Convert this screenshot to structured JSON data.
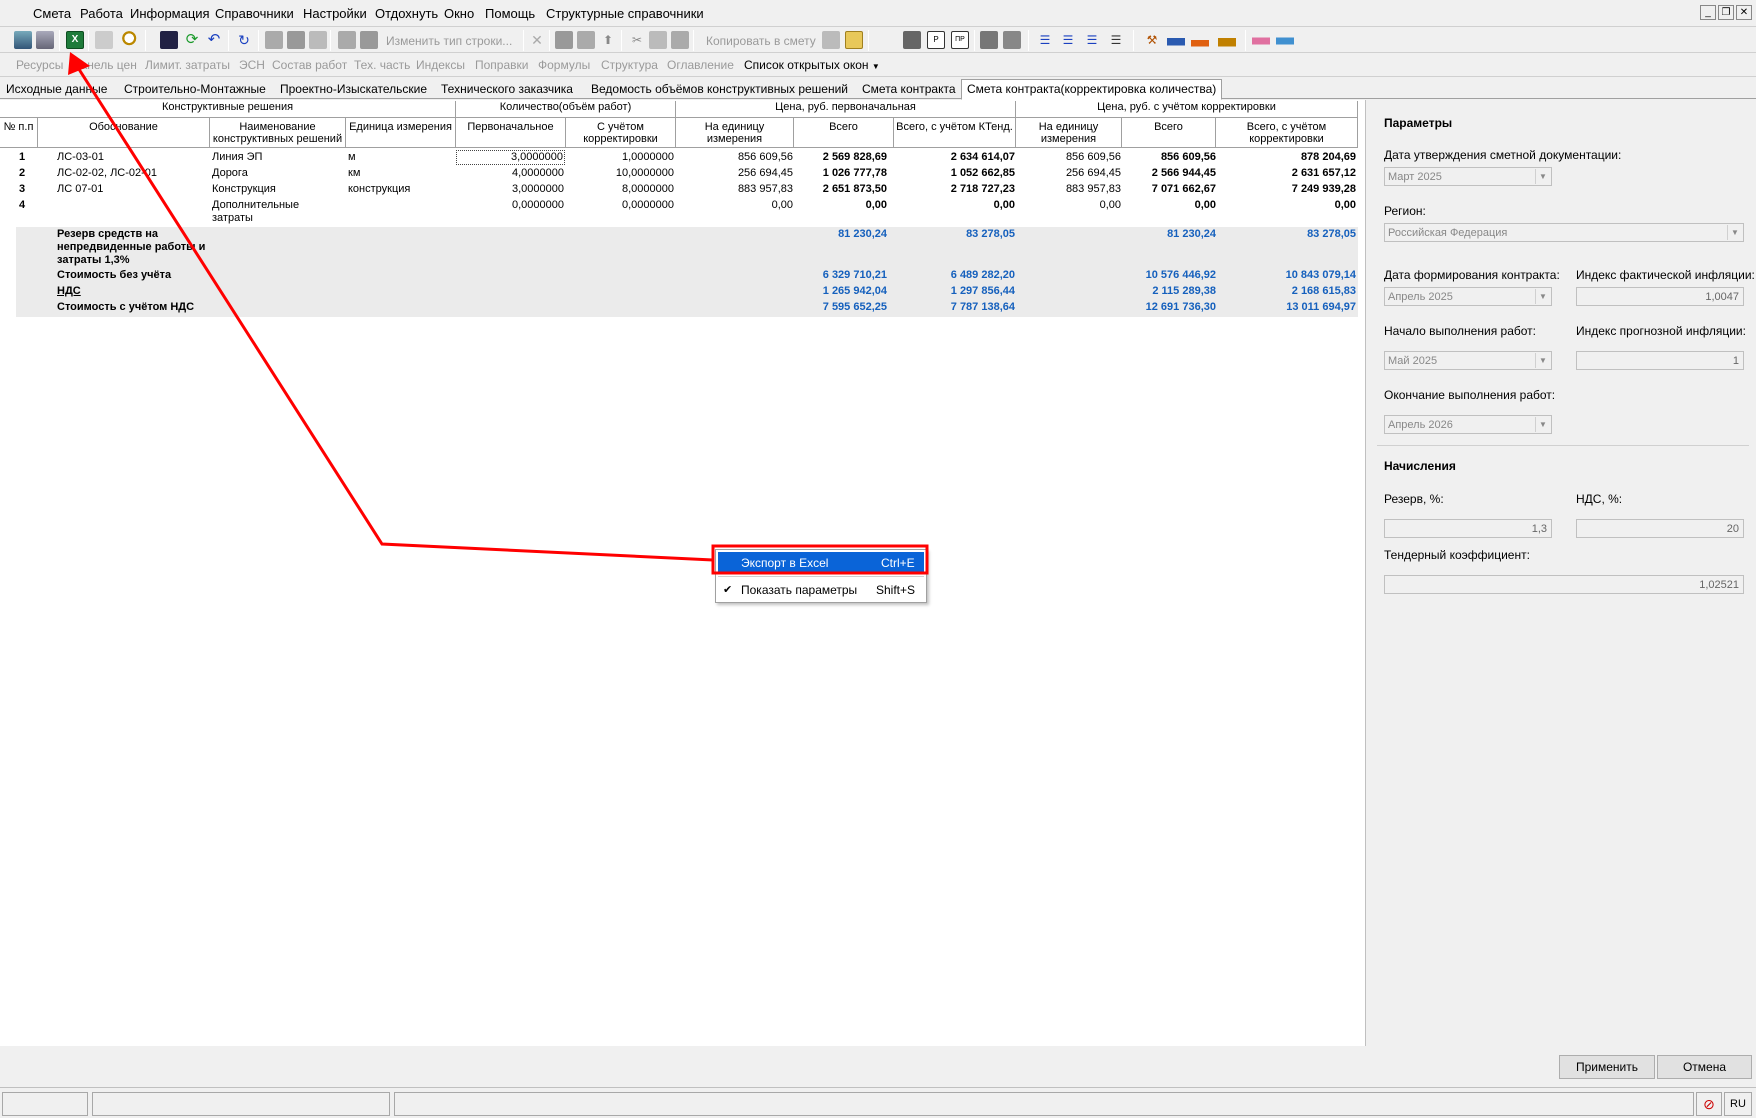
{
  "menu": {
    "items": [
      "Смета",
      "Работа",
      "Информация",
      "Справочники",
      "Настройки",
      "Отдохнуть",
      "Окно",
      "Помощь",
      "Структурные справочники"
    ]
  },
  "toolbar": {
    "change_row_type": "Изменить тип строки...",
    "copy_to_estimate": "Копировать в смету"
  },
  "nav": {
    "items": [
      "Ресурсы",
      "Панель цен",
      "Лимит. затраты",
      "ЭСН",
      "Состав работ",
      "Тех. часть",
      "Индексы",
      "Поправки",
      "Формулы",
      "Структура",
      "Оглавление"
    ],
    "open_windows": "Список открытых окон"
  },
  "tabs": [
    "Исходные данные",
    "Строительно-Монтажные",
    "Проектно-Изыскательские",
    "Технического заказчика",
    "Ведомость объёмов конструктивных решений",
    "Смета контракта",
    "Смета контракта(корректировка количества)"
  ],
  "table": {
    "group_headers": [
      "Конструктивные решения",
      "Количество(объём работ)",
      "Цена, руб. первоначальная",
      "Цена, руб. с учётом корректировки"
    ],
    "columns": [
      "№ п.п",
      "Обоснование",
      "Наименование конструктивных решений",
      "Единица измерения",
      "Первоначальное",
      "С учётом корректировки",
      "На единицу измерения",
      "Всего",
      "Всего, с учётом КТенд.",
      "На единицу измерения",
      "Всего",
      "Всего, с учётом корректировки"
    ],
    "rows": [
      [
        "1",
        "ЛС-03-01",
        "Линия ЭП",
        "м",
        "3,0000000",
        "1,0000000",
        "856 609,56",
        "2 569 828,69",
        "2 634 614,07",
        "856 609,56",
        "856 609,56",
        "878 204,69"
      ],
      [
        "2",
        "ЛС-02-02, ЛС-02-01",
        "Дорога",
        "км",
        "4,0000000",
        "10,0000000",
        "256 694,45",
        "1 026 777,78",
        "1 052 662,85",
        "256 694,45",
        "2 566 944,45",
        "2 631 657,12"
      ],
      [
        "3",
        "ЛС 07-01",
        "Конструкция",
        "конструкция",
        "3,0000000",
        "8,0000000",
        "883 957,83",
        "2 651 873,50",
        "2 718 727,23",
        "883 957,83",
        "7 071 662,67",
        "7 249 939,28"
      ],
      [
        "4",
        "",
        "Дополнительные затраты",
        "",
        "0,0000000",
        "0,0000000",
        "0,00",
        "0,00",
        "0,00",
        "0,00",
        "0,00",
        "0,00"
      ]
    ],
    "summary": [
      {
        "label": "Резерв средств на непредвиденные работы и затраты 1,3%",
        "v1": "81 230,24",
        "v2": "83 278,05",
        "v3": "81 230,24",
        "v4": "83 278,05"
      },
      {
        "label": "Стоимость без учёта",
        "v1": "6 329 710,21",
        "v2": "6 489 282,20",
        "v3": "10 576 446,92",
        "v4": "10 843 079,14"
      },
      {
        "label": "НДС",
        "v1": "1 265 942,04",
        "v2": "1 297 856,44",
        "v3": "2 115 289,38",
        "v4": "2 168 615,83"
      },
      {
        "label": "Стоимость с учётом НДС",
        "v1": "7 595 652,25",
        "v2": "7 787 138,64",
        "v3": "12 691 736,30",
        "v4": "13 011 694,97"
      }
    ]
  },
  "params": {
    "title": "Параметры",
    "approval_date_label": "Дата утверждения сметной документации:",
    "approval_date": "Март 2025",
    "region_label": "Регион:",
    "region": "Российская Федерация",
    "contract_date_label": "Дата формирования контракта:",
    "contract_date": "Апрель 2025",
    "actual_inflation_label": "Индекс фактической инфляции:",
    "actual_inflation": "1,0047",
    "start_label": "Начало выполнения работ:",
    "start": "Май 2025",
    "forecast_inflation_label": "Индекс прогнозной инфляции:",
    "forecast_inflation": "1",
    "end_label": "Окончание выполнения работ:",
    "end": "Апрель 2026",
    "accruals_title": "Начисления",
    "reserve_label": "Резерв, %:",
    "reserve": "1,3",
    "vat_label": "НДС, %:",
    "vat": "20",
    "tender_label": "Тендерный коэффициент:",
    "tender": "1,02521",
    "apply": "Применить",
    "cancel": "Отмена"
  },
  "context_menu": {
    "export": "Экспорт в Excel",
    "export_shortcut": "Ctrl+E",
    "show_params": "Показать параметры",
    "show_params_shortcut": "Shift+S",
    "check": "✔"
  },
  "status": {
    "lang": "RU"
  },
  "colors": {
    "highlight": "#0a64d8",
    "annotation": "#ff0000",
    "money_blue": "#1560bd"
  }
}
